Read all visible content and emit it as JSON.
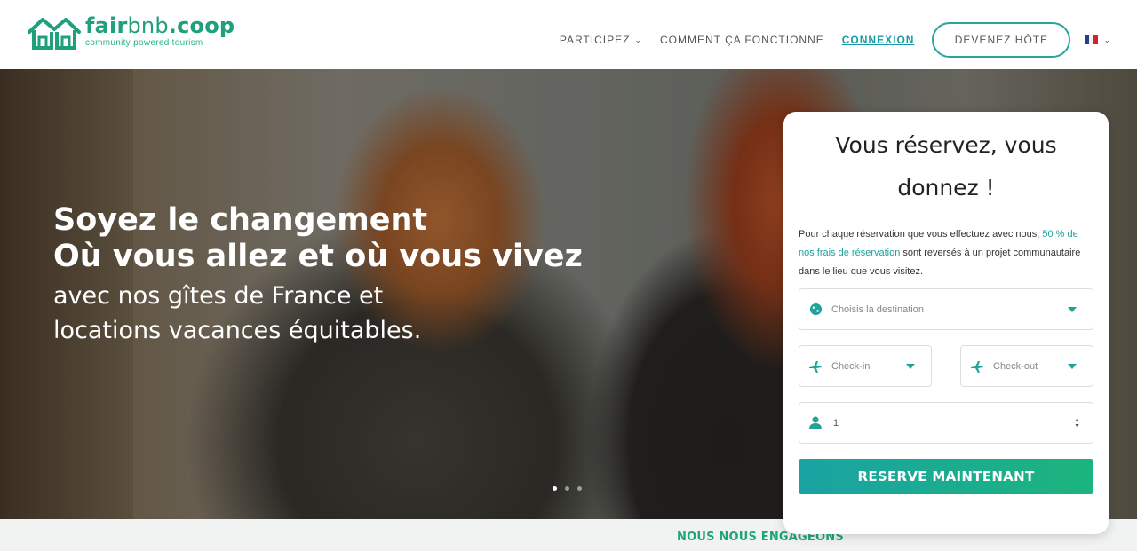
{
  "brand": {
    "name_bold": "fair",
    "name_light": "bnb",
    "name_suffix": ".coop",
    "tagline": "community powered tourism",
    "color": "#1fa07a"
  },
  "nav": {
    "items": [
      {
        "label": "PARTICIPEZ",
        "has_dropdown": true
      },
      {
        "label": "COMMENT ÇA FONCTIONNE",
        "has_dropdown": false
      },
      {
        "label": "CONNEXION",
        "active": true
      }
    ],
    "host_button": "DEVENEZ HÔTE",
    "language_flag": "fr-flag-icon"
  },
  "hero": {
    "title_line1": "Soyez le changement",
    "title_line2": "Où vous allez et où vous vivez",
    "subtitle_line1": "avec nos gîtes de France et",
    "subtitle_line2": "locations vacances équitables.",
    "slides_total": 3,
    "slide_active": 1
  },
  "booking": {
    "title": "Vous réservez, vous donnez !",
    "desc_before": "Pour chaque réservation que vous effectuez avec nous, ",
    "desc_highlight": "50 % de nos frais de réservation",
    "desc_after": " sont reversés à un projet communautaire dans le lieu que vous visitez.",
    "destination_placeholder": "Choisis la destination",
    "checkin_placeholder": "Check-in",
    "checkout_placeholder": "Check-out",
    "guests_value": "1",
    "submit_label": "RESERVE MAINTENANT",
    "accent": "#1fa39b"
  },
  "section": {
    "title": "NOUS NOUS ENGAGEONS"
  }
}
